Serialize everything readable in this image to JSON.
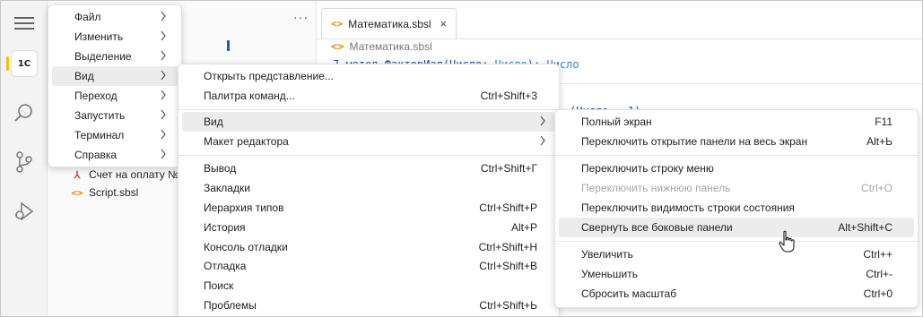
{
  "colors": {
    "accent_marker": "#f2c200",
    "code_icon": "#e08a00",
    "pdf_icon": "#d04a3a",
    "keyword": "#1a4fa0",
    "type": "#2b8ab6",
    "menu_highlight": "#ececec"
  },
  "activity_bar": {
    "icons": [
      "hamburger-menu-icon",
      "1c-logo-icon",
      "search-icon",
      "source-control-icon",
      "run-debug-icon"
    ],
    "logo_text": "1C"
  },
  "sidebar": {
    "more_label": "···",
    "files": [
      {
        "name": "Счет на оплату №",
        "icon": "pdf-icon",
        "icon_glyph": "⅄"
      },
      {
        "name": "Script.sbsl",
        "icon": "code-file-icon",
        "icon_glyph": "<>"
      }
    ]
  },
  "editor": {
    "tab": {
      "label": "Математика.sbsl",
      "icon_glyph": "<>",
      "close_glyph": "×"
    },
    "breadcrumb": {
      "label": "Математика.sbsl",
      "icon_glyph": "<>"
    },
    "code_line": {
      "prefix": "7   метод ФакторИал(Число: ",
      "type": "Число",
      "mid": "): ",
      "ret": "Число"
    },
    "code_line2": "(Число - 1)"
  },
  "menubar": {
    "items": [
      {
        "label": "Файл"
      },
      {
        "label": "Изменить"
      },
      {
        "label": "Выделение"
      },
      {
        "label": "Вид"
      },
      {
        "label": "Переход"
      },
      {
        "label": "Запустить"
      },
      {
        "label": "Терминал"
      },
      {
        "label": "Справка"
      }
    ]
  },
  "view_menu": {
    "items": [
      {
        "label": "Открыть представление...",
        "shortcut": ""
      },
      {
        "label": "Палитра команд...",
        "shortcut": "Ctrl+Shift+3"
      },
      {
        "label": "Вид",
        "shortcut": ""
      },
      {
        "label": "Макет редактора",
        "shortcut": ""
      },
      {
        "label": "Вывод",
        "shortcut": "Ctrl+Shift+Г"
      },
      {
        "label": "Закладки",
        "shortcut": ""
      },
      {
        "label": "Иерархия типов",
        "shortcut": "Ctrl+Shift+Р"
      },
      {
        "label": "История",
        "shortcut": "Alt+Р"
      },
      {
        "label": "Консоль отладки",
        "shortcut": "Ctrl+Shift+Н"
      },
      {
        "label": "Отладка",
        "shortcut": "Ctrl+Shift+В"
      },
      {
        "label": "Поиск",
        "shortcut": ""
      },
      {
        "label": "Проблемы",
        "shortcut": "Ctrl+Shift+Ь"
      }
    ]
  },
  "view_submenu": {
    "items": [
      {
        "label": "Полный экран",
        "shortcut": "F11"
      },
      {
        "label": "Переключить открытие панели на весь экран",
        "shortcut": "Alt+Ь"
      },
      {
        "label": "Переключить строку меню",
        "shortcut": ""
      },
      {
        "label": "Переключить нижнюю панель",
        "shortcut": "Ctrl+О"
      },
      {
        "label": "Переключить видимость строки состояния",
        "shortcut": ""
      },
      {
        "label": "Свернуть все боковые панели",
        "shortcut": "Alt+Shift+C"
      },
      {
        "label": "Увеличить",
        "shortcut": "Ctrl++"
      },
      {
        "label": "Уменьшить",
        "shortcut": "Ctrl+-"
      },
      {
        "label": "Сбросить масштаб",
        "shortcut": "Ctrl+0"
      }
    ]
  },
  "glyphs": {
    "submenu_arrow": "›"
  }
}
